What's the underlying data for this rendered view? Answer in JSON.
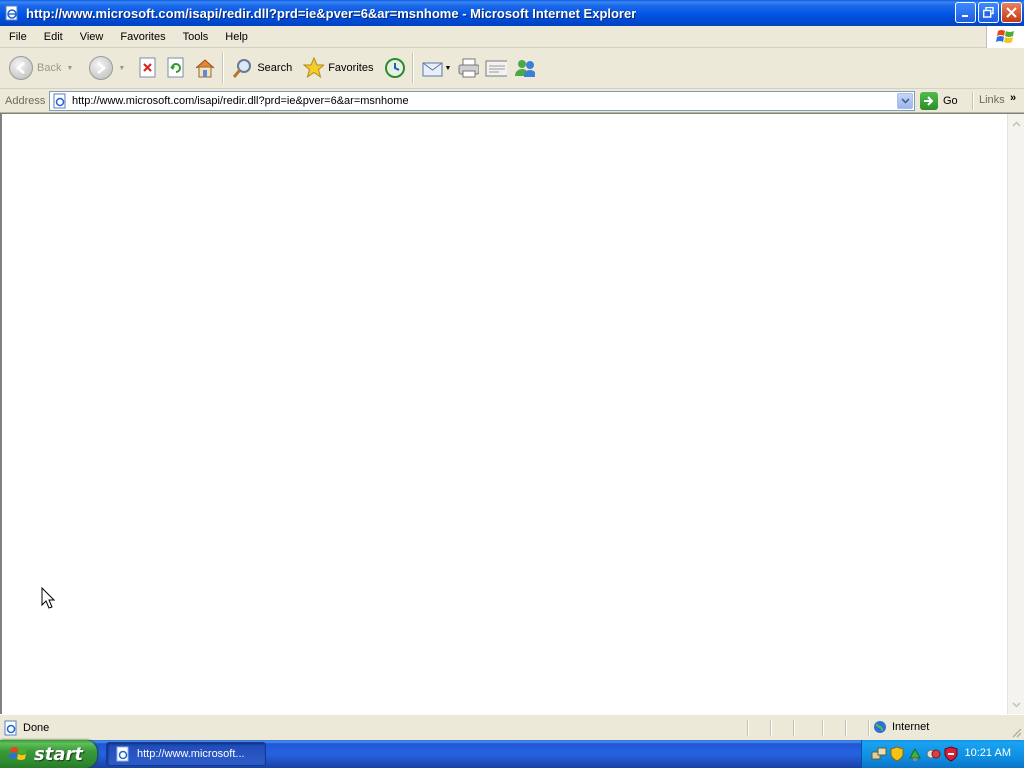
{
  "window": {
    "title": "http://www.microsoft.com/isapi/redir.dll?prd=ie&pver=6&ar=msnhome - Microsoft Internet Explorer"
  },
  "menu": [
    "File",
    "Edit",
    "View",
    "Favorites",
    "Tools",
    "Help"
  ],
  "toolbar": {
    "back_label": "Back",
    "search_label": "Search",
    "favorites_label": "Favorites"
  },
  "address": {
    "label": "Address",
    "url": "http://www.microsoft.com/isapi/redir.dll?prd=ie&pver=6&ar=msnhome",
    "go_label": "Go",
    "links_label": "Links"
  },
  "status": {
    "text": "Done",
    "zone": "Internet"
  },
  "taskbar": {
    "start_label": "start",
    "task_label": "http://www.microsoft...",
    "clock": "10:21 AM"
  },
  "colors": {
    "titlebar": "#0055e5",
    "chrome": "#ece9d8",
    "taskbar": "#2663e0",
    "start": "#3a9a3a"
  }
}
